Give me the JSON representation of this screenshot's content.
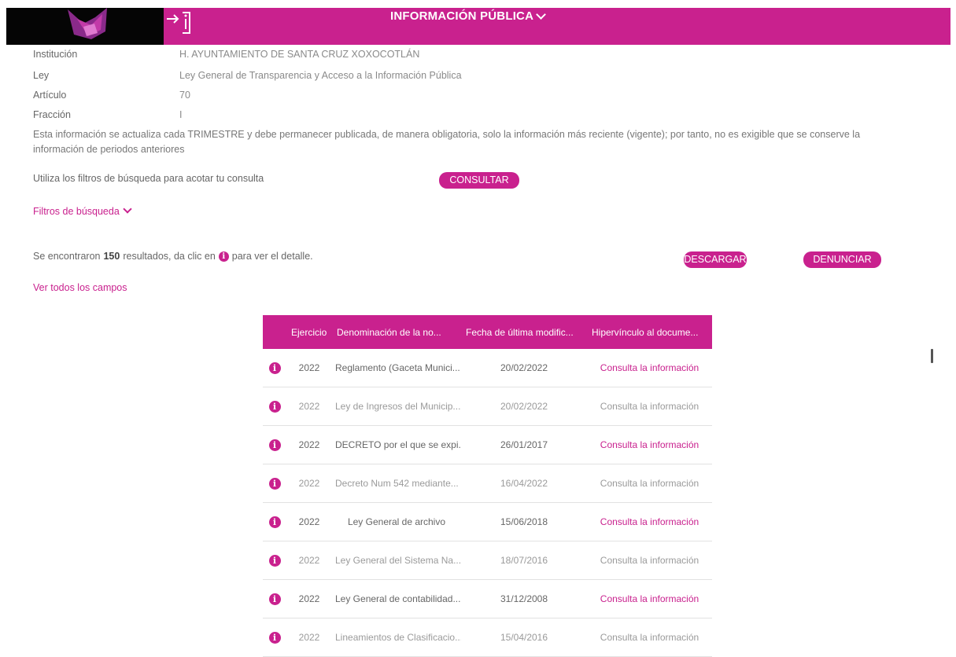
{
  "header": {
    "title": "INFORMACIÓN PÚBLICA",
    "logo_icon": "gobierno-logo",
    "login_icon": "login-icon",
    "brand_color": "#c9218e"
  },
  "meta": [
    {
      "label": "Institución",
      "value": "H. AYUNTAMIENTO DE SANTA CRUZ XOXOCOTLÁN"
    },
    {
      "label": "Ley",
      "value": "Ley General de Transparencia y Acceso a la Información Pública"
    },
    {
      "label": "Artículo",
      "value": "70"
    },
    {
      "label": "Fracción",
      "value": "I"
    }
  ],
  "notice": "Esta información se actualiza cada TRIMESTRE y debe permanecer publicada, de manera obligatoria, solo la información más reciente (vigente); por tanto, no es exigible que se conserve la información de periodos anteriores",
  "filters": {
    "hint": "Utiliza los filtros de búsqueda para acotar tu consulta",
    "consult_button": "CONSULTAR",
    "toggle_label": "Filtros de búsqueda"
  },
  "results": {
    "prefix": "Se encontraron",
    "count": "150",
    "middle": "resultados, da clic en",
    "suffix": "para ver el detalle.",
    "download_button": "DESCARGAR",
    "report_button": "DENUNCIAR",
    "show_all_link": "Ver todos los campos"
  },
  "table": {
    "headers": [
      "Ejercicio",
      "Denominación de la no...",
      "Fecha de última modific...",
      "Hipervínculo al docume..."
    ],
    "rows": [
      {
        "ejercicio": "2022",
        "denominacion": "Reglamento (Gaceta Munici...",
        "fecha": "20/02/2022",
        "link": "Consulta la información",
        "muted": false
      },
      {
        "ejercicio": "2022",
        "denominacion": "Ley de Ingresos del Municip...",
        "fecha": "20/02/2022",
        "link": "Consulta la información",
        "muted": true
      },
      {
        "ejercicio": "2022",
        "denominacion": "DECRETO por el que se expi...",
        "fecha": "26/01/2017",
        "link": "Consulta la información",
        "muted": false
      },
      {
        "ejercicio": "2022",
        "denominacion": "Decreto Num 542 mediante...",
        "fecha": "16/04/2022",
        "link": "Consulta la información",
        "muted": true
      },
      {
        "ejercicio": "2022",
        "denominacion": "Ley General de archivo",
        "fecha": "15/06/2018",
        "link": "Consulta la información",
        "muted": false
      },
      {
        "ejercicio": "2022",
        "denominacion": "Ley General del Sistema Na...",
        "fecha": "18/07/2016",
        "link": "Consulta la información",
        "muted": true
      },
      {
        "ejercicio": "2022",
        "denominacion": "Ley General de contabilidad...",
        "fecha": "31/12/2008",
        "link": "Consulta la información",
        "muted": false
      },
      {
        "ejercicio": "2022",
        "denominacion": "Lineamientos de Clasificacio...",
        "fecha": "15/04/2016",
        "link": "Consulta la información",
        "muted": true
      }
    ]
  }
}
